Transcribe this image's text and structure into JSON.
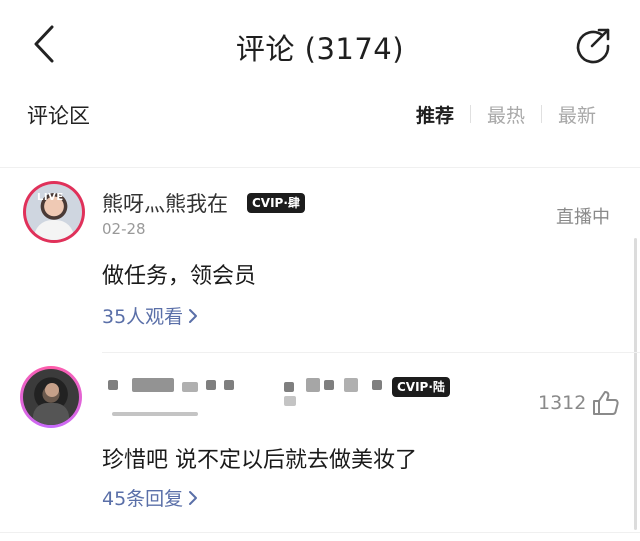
{
  "header": {
    "title": "评论 (3174)"
  },
  "section": {
    "label": "评论区",
    "tabs": [
      {
        "label": "推荐",
        "active": true
      },
      {
        "label": "最热",
        "active": false
      },
      {
        "label": "最新",
        "active": false
      }
    ]
  },
  "comments": [
    {
      "username": "熊呀灬熊我在",
      "vip_badge": "CVIP·肆",
      "date": "02-28",
      "live_badge": "LIVE",
      "status": "直播中",
      "text": "做任务，领会员",
      "watch_link": "35人观看"
    },
    {
      "vip_badge": "CVIP·陆",
      "likes": "1312",
      "text": "珍惜吧 说不定以后就去做美妆了",
      "reply_link": "45条回复"
    }
  ],
  "colors": {
    "link": "#5a6fa8",
    "muted": "#999999",
    "vip_bg": "#1c1c1c",
    "live_ring": "#e0315a"
  },
  "icons": [
    "back-arrow-icon",
    "share-icon",
    "chevron-right-icon",
    "thumbs-up-icon"
  ]
}
